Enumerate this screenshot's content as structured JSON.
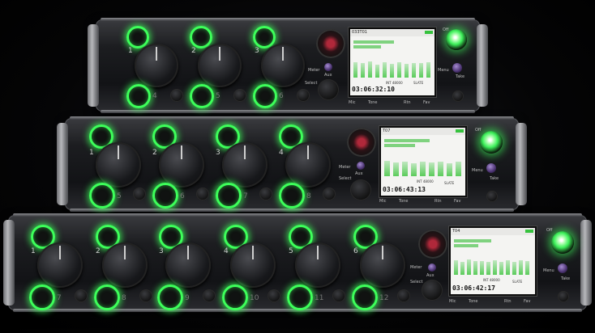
{
  "image_kind": "photo of three stacked field audio mixer-recorders with green illuminated knob rings",
  "colors": {
    "ring_glow": "#3dff5a",
    "rack": "#1c1d20",
    "screen": "#f4f4f2"
  },
  "units": [
    {
      "name": "top",
      "channels": [
        "1",
        "2",
        "3"
      ],
      "lower_channels": [
        "4",
        "5",
        "6"
      ],
      "screen": {
        "track": "033T01",
        "timecode": "03:06:32:10",
        "info": "INT 48000",
        "slate": "SLATE"
      },
      "labels": {
        "meter": "Meter",
        "aux": "Aux",
        "select": "Select",
        "menu": "Menu",
        "take": "Take",
        "off": "Off",
        "bottom": [
          "Mic",
          "Tone",
          "Rtn",
          "Fav"
        ]
      }
    },
    {
      "name": "middle",
      "channels": [
        "1",
        "2",
        "3",
        "4"
      ],
      "lower_channels": [
        "5",
        "6",
        "7",
        "8"
      ],
      "screen": {
        "track": "T07",
        "timecode": "03:06:43:13",
        "info": "INT 48000",
        "slate": "SLATE"
      },
      "labels": {
        "meter": "Meter",
        "aux": "Aux",
        "select": "Select",
        "menu": "Menu",
        "take": "Take",
        "off": "Off",
        "bottom": [
          "Mic",
          "Tone",
          "Rtn",
          "Fav"
        ]
      }
    },
    {
      "name": "bottom",
      "channels": [
        "1",
        "2",
        "3",
        "4",
        "5",
        "6"
      ],
      "lower_channels": [
        "7",
        "8",
        "9",
        "10",
        "11",
        "12"
      ],
      "screen": {
        "track": "T04",
        "timecode": "03:06:42:17",
        "info": "INT 48000",
        "slate": "SLATE"
      },
      "labels": {
        "meter": "Meter",
        "aux": "Aux",
        "select": "Select",
        "menu": "Menu",
        "take": "Take",
        "off": "Off",
        "bottom": [
          "Mic",
          "Tone",
          "Rtn",
          "Fav"
        ]
      }
    }
  ]
}
